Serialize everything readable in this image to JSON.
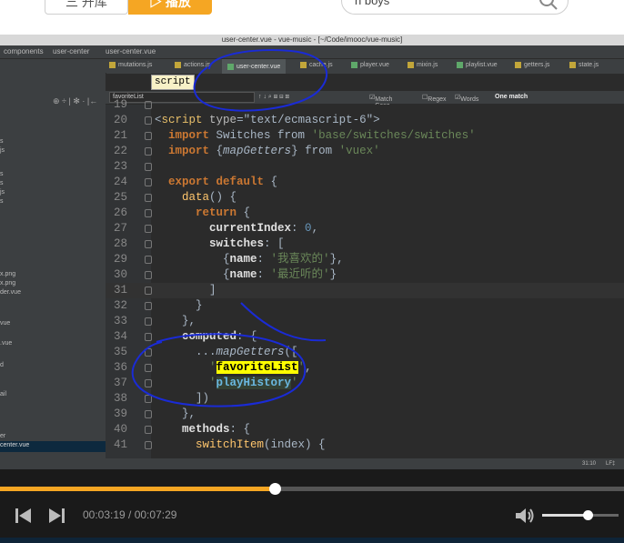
{
  "topbar": {
    "library_label": "三 开库",
    "play_label": "▷ 播放",
    "search_value": "h boys"
  },
  "ide": {
    "window_title": "user-center.vue - vue-music - [~/Code/imooc/vue-music]",
    "breadcrumb": [
      "components",
      "user-center",
      "user-center.vue"
    ],
    "tabs": [
      "mutations.js",
      "actions.js",
      "user-center.vue",
      "cache.js",
      "player.vue",
      "mixin.js",
      "playlist.vue",
      "getters.js",
      "state.js"
    ],
    "find": {
      "query": "favoriteList",
      "match_case": "Match Case",
      "regex": "Regex",
      "words": "Words",
      "result": "One match"
    },
    "tooltip": "script",
    "sidebar_items": [
      "s",
      "js",
      "s",
      "s",
      "js",
      "s",
      "x.png",
      "x.png",
      "der.vue",
      "vue",
      ".vue",
      "d",
      "ail",
      "er",
      "center.vue"
    ],
    "status": {
      "position": "31:10",
      "line_sep": "LF‡"
    },
    "code_lines": [
      {
        "n": "19",
        "text": ""
      },
      {
        "n": "20",
        "text": "<script type=\"text/ecmascript-6\">"
      },
      {
        "n": "21",
        "text": "  import Switches from 'base/switches/switches'"
      },
      {
        "n": "22",
        "text": "  import {mapGetters} from 'vuex'"
      },
      {
        "n": "23",
        "text": ""
      },
      {
        "n": "24",
        "text": "  export default {"
      },
      {
        "n": "25",
        "text": "    data() {"
      },
      {
        "n": "26",
        "text": "      return {"
      },
      {
        "n": "27",
        "text": "        currentIndex: 0,"
      },
      {
        "n": "28",
        "text": "        switches: ["
      },
      {
        "n": "29",
        "text": "          {name: '我喜欢的'},"
      },
      {
        "n": "30",
        "text": "          {name: '最近听的'}"
      },
      {
        "n": "31",
        "text": "        ]"
      },
      {
        "n": "32",
        "text": "      }"
      },
      {
        "n": "33",
        "text": "    },"
      },
      {
        "n": "34",
        "text": "    computed: {"
      },
      {
        "n": "35",
        "text": "      ...mapGetters(["
      },
      {
        "n": "36",
        "text": "        'favoriteList',"
      },
      {
        "n": "37",
        "text": "        'playHistory'"
      },
      {
        "n": "38",
        "text": "      ])"
      },
      {
        "n": "39",
        "text": "    },"
      },
      {
        "n": "40",
        "text": "    methods: {"
      },
      {
        "n": "41",
        "text": "      switchItem(index) {"
      }
    ]
  },
  "player": {
    "current_time": "00:03:19",
    "total_time": "00:07:29",
    "time_display": "00:03:19 / 00:07:29",
    "progress_fraction": 0.44,
    "volume_fraction": 0.6
  },
  "colors": {
    "accent": "#f5a623",
    "editor_bg": "#2b2b2b",
    "keyword": "#cc7832",
    "string": "#6a8759",
    "annotation_ink": "#1a2bd6"
  }
}
